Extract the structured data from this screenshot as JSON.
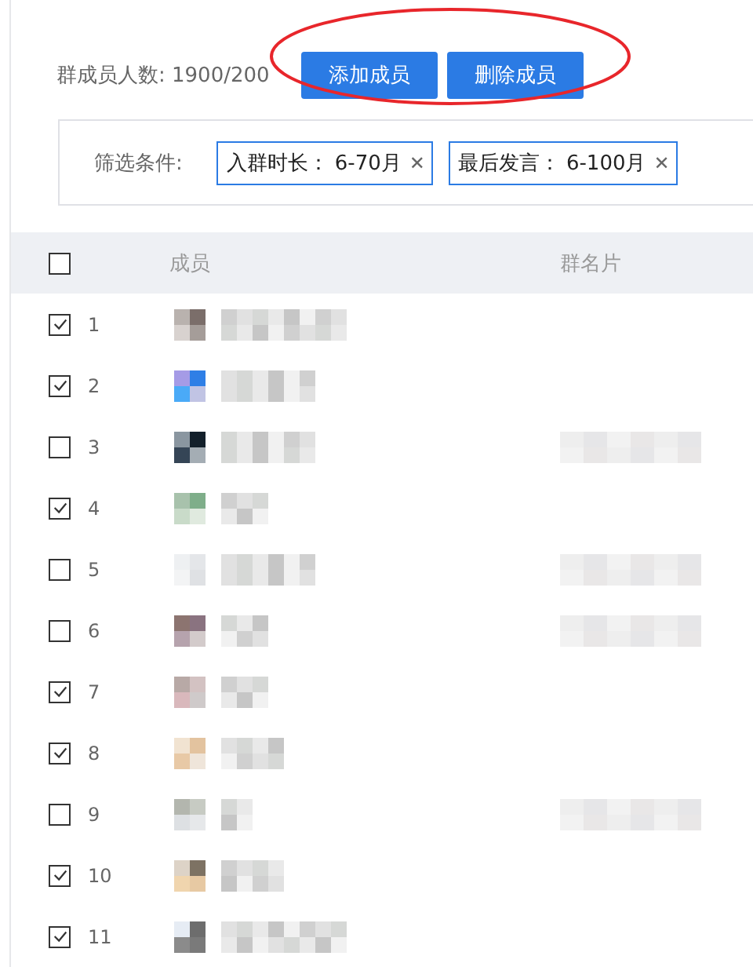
{
  "summary": {
    "count_text": "群成员人数: 1900/200",
    "buttons": [
      {
        "label": "添加成员"
      },
      {
        "label": "删除成员"
      }
    ],
    "highlighted": true
  },
  "filter": {
    "label": "筛选条件:",
    "tags": [
      {
        "label": "入群时长：",
        "value": "6-70月",
        "close": "✕"
      },
      {
        "label": "最后发言：",
        "value": "6-100月",
        "close": "✕"
      }
    ]
  },
  "table": {
    "header_checked": false,
    "columns": [
      "成员",
      "群名片"
    ],
    "rows": [
      {
        "number": "1",
        "checked": true,
        "card_blurred": false
      },
      {
        "number": "2",
        "checked": true,
        "card_blurred": false
      },
      {
        "number": "3",
        "checked": false,
        "card_blurred": true
      },
      {
        "number": "4",
        "checked": true,
        "card_blurred": false
      },
      {
        "number": "5",
        "checked": false,
        "card_blurred": true
      },
      {
        "number": "6",
        "checked": false,
        "card_blurred": true
      },
      {
        "number": "7",
        "checked": true,
        "card_blurred": false
      },
      {
        "number": "8",
        "checked": true,
        "card_blurred": false
      },
      {
        "number": "9",
        "checked": false,
        "card_blurred": true
      },
      {
        "number": "10",
        "checked": true,
        "card_blurred": false
      },
      {
        "number": "11",
        "checked": true,
        "card_blurred": false
      }
    ]
  }
}
